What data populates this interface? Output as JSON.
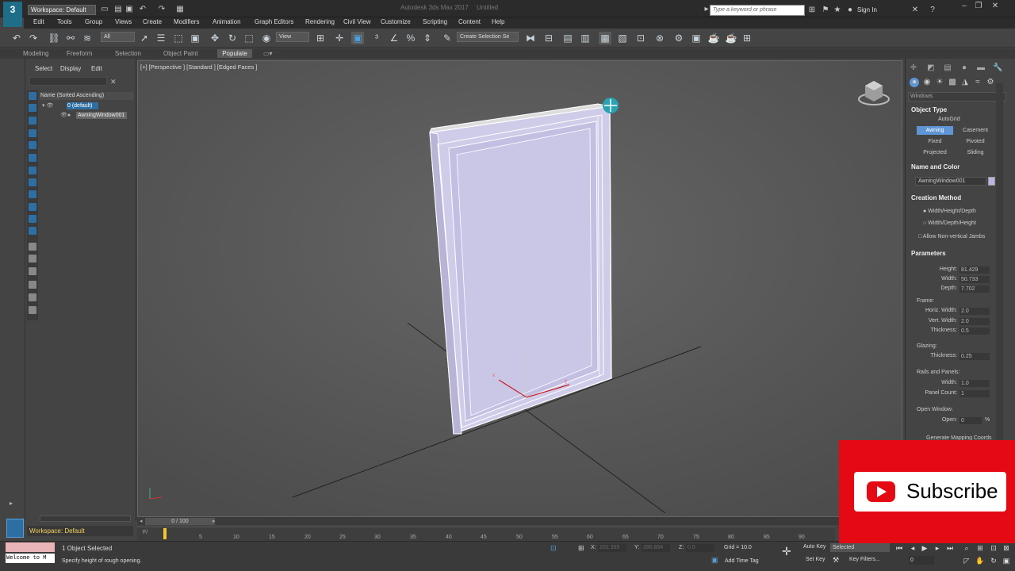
{
  "app": {
    "logo": "3",
    "workspace": "Workspace: Default",
    "title": "Autodesk 3ds Max 2017",
    "document": "Untitled",
    "search_placeholder": "Type a keyword or phrase",
    "signin": "Sign In"
  },
  "menu": [
    "Edit",
    "Tools",
    "Group",
    "Views",
    "Create",
    "Modifiers",
    "Animation",
    "Graph Editors",
    "Rendering",
    "Civil View",
    "Customize",
    "Scripting",
    "Content",
    "Help"
  ],
  "toolbar": {
    "selection_filter": "All",
    "ref_coord": "View",
    "selection_set": "Create Selection Se"
  },
  "ribbon": {
    "tabs": [
      "Modeling",
      "Freeform",
      "Selection",
      "Object Paint"
    ],
    "active": "Populate"
  },
  "explorer": {
    "tabs": [
      "Select",
      "Display",
      "Edit"
    ],
    "header": "Name (Sorted Ascending)",
    "layer": "0 (default)",
    "object": "AwningWindow001",
    "workspace": "Workspace: Default"
  },
  "viewport": {
    "label": "[+] [Perspective ] [Standard ] [Edged Faces ]",
    "axis_z": "z",
    "gizmo_x": "x",
    "gizmo_y": "y"
  },
  "command_panel": {
    "category": "Windows",
    "object_type": {
      "title": "Object Type",
      "autogrid": "AutoGrid",
      "buttons": [
        "Awning",
        "Casement",
        "Fixed",
        "Pivoted",
        "Projected",
        "Sliding"
      ],
      "selected": "Awning"
    },
    "name_color": {
      "title": "Name and Color",
      "name": "AwningWindow001",
      "color": "#b9b6e6"
    },
    "creation": {
      "title": "Creation Method",
      "opt1": "Width/Height/Depth",
      "opt2": "Width/Depth/Height",
      "allow": "Allow Non-vertical Jambs"
    },
    "params": {
      "title": "Parameters",
      "height_l": "Height:",
      "height": "81.429",
      "width_l": "Width:",
      "width": "50.733",
      "depth_l": "Depth:",
      "depth": "7.702",
      "frame": "Frame:",
      "hw_l": "Horiz. Width:",
      "hw": "2.0",
      "vw_l": "Vert. Width:",
      "vw": "2.0",
      "th_l": "Thickness:",
      "th": "0.5",
      "glazing": "Glazing:",
      "gth_l": "Thickness:",
      "gth": "0.25",
      "rails": "Rails and Panels:",
      "rw_l": "Width:",
      "rw": "1.0",
      "pc_l": "Panel Count:",
      "pc": "1",
      "open_title": "Open Window:",
      "open_l": "Open:",
      "open": "0",
      "open_unit": "%",
      "gen": "Generate Mapping Coords"
    }
  },
  "timeline": {
    "frame": "0 / 100",
    "ticks": [
      "5",
      "10",
      "15",
      "20",
      "25",
      "30",
      "35",
      "40",
      "45",
      "50",
      "55",
      "60",
      "65",
      "70",
      "75",
      "80",
      "85",
      "90"
    ]
  },
  "status": {
    "maxscript": "Welcome to M",
    "selected": "1 Object Selected",
    "prompt": "Specify height of rough opening.",
    "x_l": "X:",
    "x": "202.359",
    "y_l": "Y:",
    "y": "286.894",
    "z_l": "Z:",
    "z": "0.0",
    "grid": "Grid = 10.0",
    "add_time_tag": "Add Time Tag",
    "autokey": "Auto Key",
    "setkey": "Set Key",
    "selected_dd": "Selected",
    "keyfilters": "Key Filters...",
    "frame": "0"
  },
  "banner": {
    "text": "Subscribe"
  }
}
